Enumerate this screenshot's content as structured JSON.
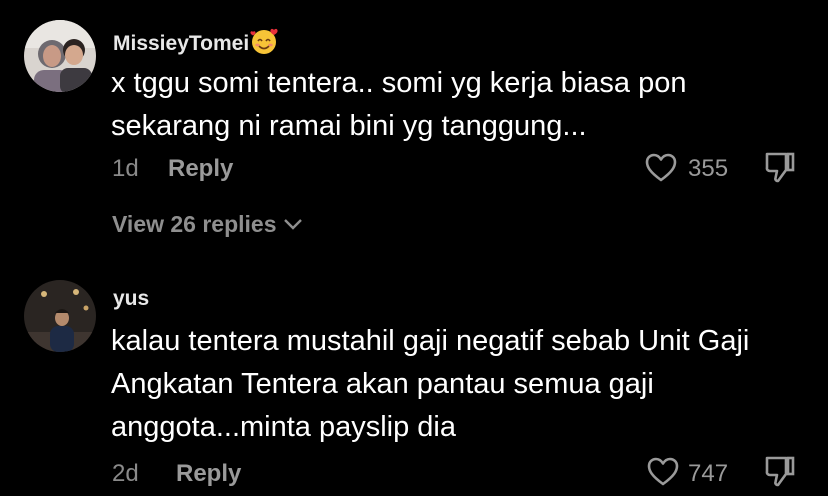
{
  "comments": [
    {
      "username": "MissieyTomei",
      "emoji_icon": "smiling-face-with-hearts-emoji",
      "text": "x tggu somi tentera.. somi yg kerja biasa pon sekarang ni ramai bini yg tanggung...",
      "time": "1d",
      "reply_label": "Reply",
      "likes": "355",
      "view_replies": "View 26 replies"
    },
    {
      "username": "yus",
      "text": "kalau tentera mustahil gaji negatif sebab Unit Gaji Angkatan Tentera akan pantau semua gaji anggota...minta payslip dia",
      "time": "2d",
      "reply_label": "Reply",
      "likes": "747"
    }
  ],
  "colors": {
    "background": "#000000",
    "primary_text": "#ffffff",
    "secondary_text": "#8a8a8a"
  }
}
